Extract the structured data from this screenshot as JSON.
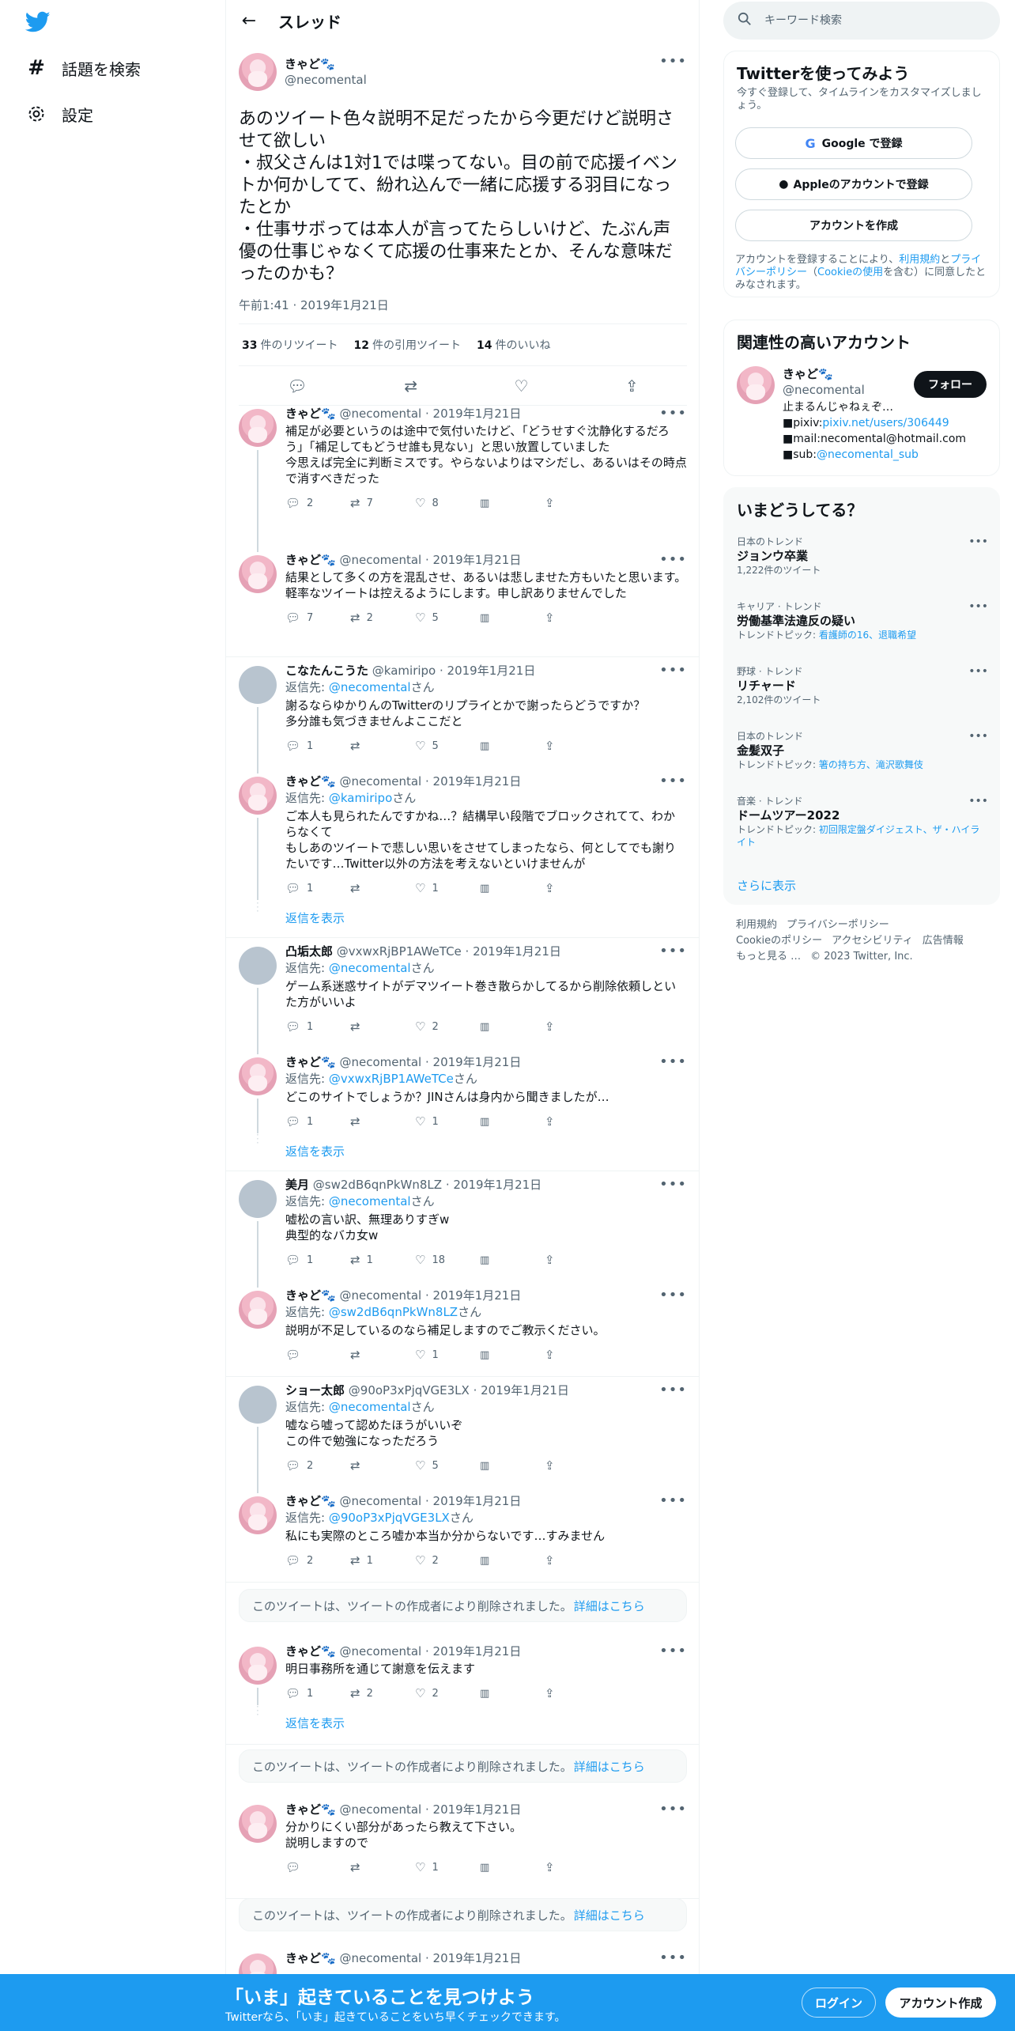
{
  "nav": {
    "explore": "話題を検索",
    "settings": "設定"
  },
  "header": {
    "title": "スレッド"
  },
  "focal": {
    "display_name": "きゃど🐾",
    "username": "@necomental",
    "text": "あのツイート色々説明不足だったから今更だけど説明させて欲しい\n・叔父さんは1対1では喋ってない。目の前で応援イベントか何かしてて、紛れ込んで一緒に応援する羽目になったとか\n・仕事サボっては本人が言ってたらしいけど、たぶん声優の仕事じゃなくて応援の仕事来たとか、そんな意味だったのかも？",
    "time": "午前1:41 · 2019年1月21日",
    "retweets_count": "33",
    "retweets_label": "件のリツイート",
    "quotes_count": "12",
    "quotes_label": "件の引用ツイート",
    "likes_count": "14",
    "likes_label": "件のいいね"
  },
  "replies": [
    {
      "name": "きゃど🐾",
      "meta": "@necomental · 2019年1月21日",
      "replyto": "",
      "text": "補足が必要というのは途中で気付いたけど、「どうせすぐ沈静化するだろう」「補足してもどうせ誰も見ない」と思い放置していました\n今思えば完全に判断ミスです。やらないよりはマシだし、あるいはその時点で消すべきだった",
      "reply": "2",
      "retweet": "7",
      "like": "8"
    },
    {
      "name": "きゃど🐾",
      "meta": "@necomental · 2019年1月21日",
      "replyto": "",
      "text": "結果として多くの方を混乱させ、あるいは悲しませた方もいたと思います。\n軽率なツイートは控えるようにします。申し訳ありませんでした",
      "reply": "7",
      "retweet": "2",
      "like": "5"
    },
    {
      "name": "こなたんこうた",
      "meta": "@kamiripo · 2019年1月21日",
      "replyto": "@necomental",
      "text": "謝るならゆかりんのTwitterのリプライとかで謝ったらどうですか？\n多分誰も気づきませんよここだと",
      "reply": "1",
      "retweet": "",
      "like": "5"
    },
    {
      "name": "きゃど🐾",
      "meta": "@necomental · 2019年1月21日",
      "replyto": "@kamiripo",
      "text": "ご本人も見られたんですかね…？結構早い段階でブロックされてて、わからなくて\nもしあのツイートで悲しい思いをさせてしまったなら、何としてでも謝りたいです…Twitter以外の方法を考えないといけませんが",
      "reply": "1",
      "retweet": "",
      "like": "1"
    },
    {
      "name": "凸垢太郎",
      "meta": "@vxwxRjBP1AWeTCe · 2019年1月21日",
      "replyto": "@necomental",
      "text": "ゲーム系迷惑サイトがデマツイート巻き散らかしてるから削除依頼しといた方がいいよ",
      "reply": "1",
      "retweet": "",
      "like": "2"
    },
    {
      "name": "きゃど🐾",
      "meta": "@necomental · 2019年1月21日",
      "replyto": "@vxwxRjBP1AWeTCe",
      "text": "どこのサイトでしょうか？JINさんは身内から聞きましたが…",
      "reply": "1",
      "retweet": "",
      "like": "1"
    },
    {
      "name": "美月",
      "meta": "@sw2dB6qnPkWn8LZ · 2019年1月21日",
      "replyto": "@necomental",
      "text": "嘘松の言い訳、無理ありすぎw\n典型的なバカ女w",
      "reply": "1",
      "retweet": "1",
      "like": "18"
    },
    {
      "name": "きゃど🐾",
      "meta": "@necomental · 2019年1月21日",
      "replyto": "@sw2dB6qnPkWn8LZ",
      "text": "説明が不足しているのなら補足しますのでご教示ください。",
      "reply": "",
      "retweet": "",
      "like": "1"
    },
    {
      "name": "ショー太郎",
      "meta": "@90oP3xPjqVGE3LX · 2019年1月21日",
      "replyto": "@necomental",
      "text": "嘘なら嘘って認めたほうがいいぞ\nこの件で勉強になっただろう",
      "reply": "2",
      "retweet": "",
      "like": "5"
    },
    {
      "name": "きゃど🐾",
      "meta": "@necomental · 2019年1月21日",
      "replyto": "@90oP3xPjqVGE3LX",
      "text": "私にも実際のところ嘘か本当か分からないです…すみません",
      "reply": "2",
      "retweet": "1",
      "like": "2"
    },
    {
      "name": "きゃど🐾",
      "meta": "@necomental · 2019年1月21日",
      "replyto": "",
      "text": "明日事務所を通じて謝意を伝えます",
      "reply": "1",
      "retweet": "2",
      "like": "2"
    },
    {
      "name": "きゃど🐾",
      "meta": "@necomental · 2019年1月21日",
      "replyto": "",
      "text": "分かりにくい部分があったら教えて下さい。\n説明しますので",
      "reply": "",
      "retweet": "",
      "like": "1"
    },
    {
      "name": "きゃど🐾",
      "meta": "@necomental · 2019年1月21日",
      "replyto": "",
      "text": "",
      "reply": "",
      "retweet": "",
      "like": ""
    }
  ],
  "reply_prefix": "返信先: ",
  "reply_suffix": "さん",
  "show_replies": "返信を表示",
  "deleted": {
    "text": "このツイートは、ツイートの作成者により削除されました。",
    "link": "詳細はこちら"
  },
  "search": {
    "placeholder": "キーワード検索"
  },
  "signup": {
    "title": "Twitterを使ってみよう",
    "sub": "今すぐ登録して、タイムラインをカスタマイズしましょう。",
    "google": "Google で登録",
    "apple": "Appleのアカウントで登録",
    "create": "アカウントを作成",
    "terms_1": "アカウントを登録することにより、",
    "terms_link1": "利用規約",
    "terms_2": "と",
    "terms_link2": "プライバシーポリシー",
    "terms_3": "（",
    "terms_link3": "Cookieの使用",
    "terms_4": "を含む）に同意したとみなされます。"
  },
  "related": {
    "title": "関連性の高いアカウント",
    "name": "きゃど🐾",
    "username": "@necomental",
    "follow": "フォロー",
    "bio_1": "止まるんじゃねぇぞ…\n■pixiv:",
    "bio_link1": "pixiv.net/users/306449",
    "bio_2": "\n■mail:necomental@hotmail.com ■sub:",
    "bio_link2": "@necomental_sub"
  },
  "trends": {
    "title": "いまどうしてる？",
    "items": [
      {
        "context": "日本のトレンド",
        "name": "ジョンウ卒業",
        "count": "1,222件のツイート",
        "topic_label": "",
        "topic": ""
      },
      {
        "context": "キャリア · トレンド",
        "name": "労働基準法違反の疑い",
        "count": "",
        "topic_label": "トレンドトピック: ",
        "topic": "看護師の16、退職希望"
      },
      {
        "context": "野球 · トレンド",
        "name": "リチャード",
        "count": "2,102件のツイート",
        "topic_label": "",
        "topic": ""
      },
      {
        "context": "日本のトレンド",
        "name": "金髪双子",
        "count": "",
        "topic_label": "トレンドトピック: ",
        "topic": "箸の持ち方、滝沢歌舞伎"
      },
      {
        "context": "音楽 · トレンド",
        "name": "ドームツアー2022",
        "count": "",
        "topic_label": "トレンドトピック: ",
        "topic": "初回限定盤ダイジェスト、ザ・ハイライト"
      }
    ],
    "show_more": "さらに表示"
  },
  "footer": {
    "terms": "利用規約",
    "privacy": "プライバシーポリシー",
    "cookie": "Cookieのポリシー",
    "accessibility": "アクセシビリティ",
    "ads": "広告情報",
    "more": "もっと見る …",
    "copyright": "© 2023 Twitter, Inc."
  },
  "bottombar": {
    "title": "「いま」起きていることを見つけよう",
    "sub": "Twitterなら、「いま」起きていることをいち早くチェックできます。",
    "login": "ログイン",
    "create": "アカウント作成"
  },
  "colors": {
    "accent": "#1d9bf0",
    "text": "#0f1419",
    "muted": "#536471",
    "border": "#eff3f4"
  }
}
